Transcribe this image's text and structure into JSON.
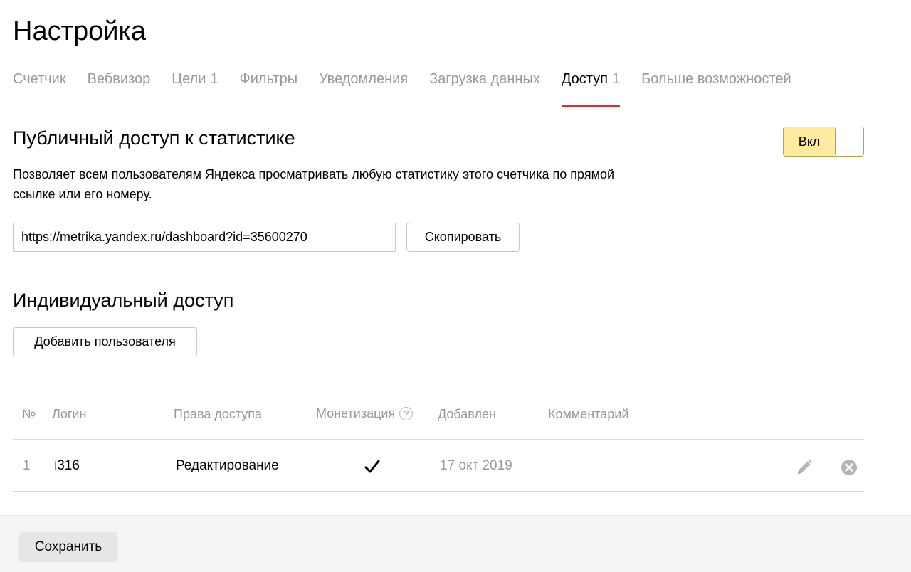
{
  "page": {
    "title": "Настройка"
  },
  "tabs": [
    {
      "label": "Счетчик",
      "count": ""
    },
    {
      "label": "Вебвизор",
      "count": ""
    },
    {
      "label": "Цели",
      "count": "1"
    },
    {
      "label": "Фильтры",
      "count": ""
    },
    {
      "label": "Уведомления",
      "count": ""
    },
    {
      "label": "Загрузка данных",
      "count": ""
    },
    {
      "label": "Доступ",
      "count": "1",
      "active": true
    },
    {
      "label": "Больше возможностей",
      "count": ""
    }
  ],
  "public_access": {
    "title": "Публичный доступ к статистике",
    "description": "Позволяет всем пользователям Яндекса просматривать любую статистику этого счетчика по прямой ссылке или его номеру.",
    "toggle_label": "Вкл",
    "toggle_state": "on",
    "url_value": "https://metrika.yandex.ru/dashboard?id=35600270",
    "copy_label": "Скопировать"
  },
  "individual_access": {
    "title": "Индивидуальный доступ",
    "add_user_label": "Добавить пользователя",
    "columns": {
      "number": "№",
      "login": "Логин",
      "rights": "Права доступа",
      "monetization": "Монетизация",
      "added": "Добавлен",
      "comment": "Комментарий"
    },
    "help_glyph": "?",
    "rows": [
      {
        "number": "1",
        "login_first": "i",
        "login_rest": "316",
        "rights": "Редактирование",
        "monetization": true,
        "added": "17 окт 2019",
        "comment": ""
      }
    ]
  },
  "footer": {
    "save_label": "Сохранить"
  },
  "colors": {
    "accent_red": "#e32a2a",
    "toggle_yellow": "#ffeba0",
    "muted_text": "#999999",
    "footer_bg": "#f5f4f2"
  },
  "icons": {
    "help": "help-icon",
    "check": "check-icon",
    "edit": "pencil-icon",
    "remove": "close-circle-icon"
  }
}
